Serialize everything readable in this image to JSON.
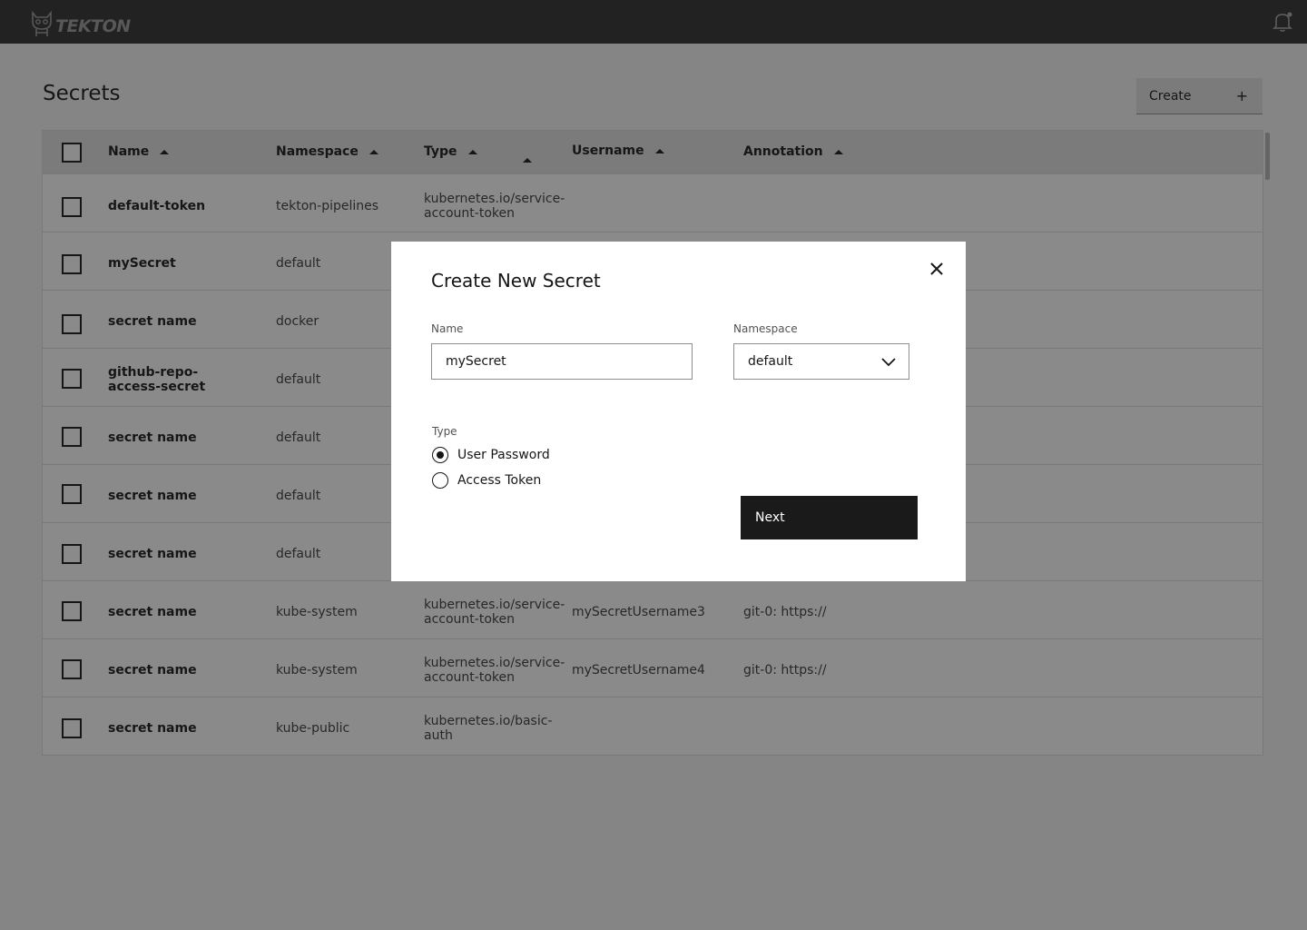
{
  "header": {
    "logo_text": "TEKTON"
  },
  "page": {
    "title": "Secrets",
    "create_label": "Create",
    "create_icon": "+"
  },
  "table": {
    "columns": [
      {
        "label": "Name"
      },
      {
        "label": "Namespace"
      },
      {
        "label": "Type"
      },
      {
        "label": ""
      },
      {
        "label": "Username"
      },
      {
        "label": "Annotation"
      }
    ],
    "rows": [
      {
        "name": "default-token",
        "namespace": "tekton-pipelines",
        "type": "kubernetes.io/service-account-token",
        "username": "",
        "annotation": ""
      },
      {
        "name": "mySecret",
        "namespace": "default",
        "type": "",
        "username": "",
        "annotation": ""
      },
      {
        "name": "secret name",
        "namespace": "docker",
        "type": "",
        "username": "",
        "annotation": ""
      },
      {
        "name": "github-repo-access-secret",
        "namespace": "default",
        "type": "",
        "username": "",
        "annotation": ""
      },
      {
        "name": "secret name",
        "namespace": "default",
        "type": "",
        "username": "",
        "annotation": ""
      },
      {
        "name": "secret name",
        "namespace": "default",
        "type": "",
        "username": "",
        "annotation": ""
      },
      {
        "name": "secret name",
        "namespace": "default",
        "type": "",
        "username": "",
        "annotation": ""
      },
      {
        "name": "secret name",
        "namespace": "kube-system",
        "type": "kubernetes.io/service-account-token",
        "username": "mySecretUsername3",
        "annotation": "git-0: https://"
      },
      {
        "name": "secret name",
        "namespace": "kube-system",
        "type": "kubernetes.io/service-account-token",
        "username": "mySecretUsername4",
        "annotation": "git-0: https://"
      },
      {
        "name": "secret name",
        "namespace": "kube-public",
        "type": "kubernetes.io/basic-auth",
        "username": "",
        "annotation": ""
      }
    ]
  },
  "modal": {
    "title": "Create New Secret",
    "name_label": "Name",
    "name_value": "mySecret",
    "namespace_label": "Namespace",
    "namespace_value": "default",
    "type_label": "Type",
    "type_options": [
      {
        "label": "User Password",
        "checked": true
      },
      {
        "label": "Access Token",
        "checked": false
      }
    ],
    "next_label": "Next"
  }
}
